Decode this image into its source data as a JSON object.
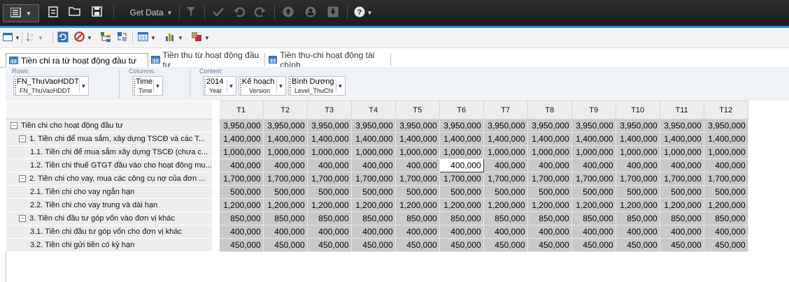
{
  "toolbar_top": {
    "get_data_label": "Get Data"
  },
  "tabs": [
    {
      "label": "Tiền chi ra từ hoạt động đầu tư"
    },
    {
      "label": "Tiền thu từ hoạt động đầu tư"
    },
    {
      "label": "Tiền thu-chi hoạt động tài chính"
    }
  ],
  "pov": {
    "rows_label": "Rows:",
    "columns_label": "Columns:",
    "context_label": "Context:",
    "rows_chip": {
      "value": "FN_ThuVaoHDDT",
      "dimension": "FN_ThuVaoHDDT"
    },
    "columns_chip": {
      "value": "Time",
      "dimension": "Time"
    },
    "context_chips": [
      {
        "value": "2014",
        "dimension": "Year"
      },
      {
        "value": "Kế hoạch",
        "dimension": "Version"
      },
      {
        "value": "Bình Dương",
        "dimension": "Level_ThuChi"
      }
    ]
  },
  "grid": {
    "columns": [
      "T1",
      "T2",
      "T3",
      "T4",
      "T5",
      "T6",
      "T7",
      "T8",
      "T9",
      "T10",
      "T11",
      "T12"
    ],
    "rows": [
      {
        "label": "Tiền chi cho hoạt động đầu tư",
        "value": "3,950,000"
      },
      {
        "label": "1. Tiền chi để mua sắm, xây dựng TSCĐ và các T...",
        "value": "1,400,000"
      },
      {
        "label": "1.1. Tiền chi để mua sắm xây dựng TSCĐ (chưa c...",
        "value": "1,000,000"
      },
      {
        "label": "1.2. Tiền chi thuế GTGT đầu vào cho hoạt động mu...",
        "value": "400,000"
      },
      {
        "label": "2. Tiền chi cho vay, mua các công cụ nợ của đơn ...",
        "value": "1,700,000"
      },
      {
        "label": "2.1. Tiền chi cho vay ngắn hạn",
        "value": "500,000"
      },
      {
        "label": "2.2. Tiền chi cho vay trung và dài hạn",
        "value": "1,200,000"
      },
      {
        "label": "3. Tiền chi đầu tư góp vốn vào đơn vị khác",
        "value": "850,000"
      },
      {
        "label": "3.1. Tiền chi đầu tư góp vốn cho đơn vị khác",
        "value": "400,000"
      },
      {
        "label": "3.2. Tiền chi gửi tiền có kỳ hạn",
        "value": "450,000"
      }
    ],
    "selected_cell": {
      "row": 3,
      "col": "T6"
    }
  }
}
